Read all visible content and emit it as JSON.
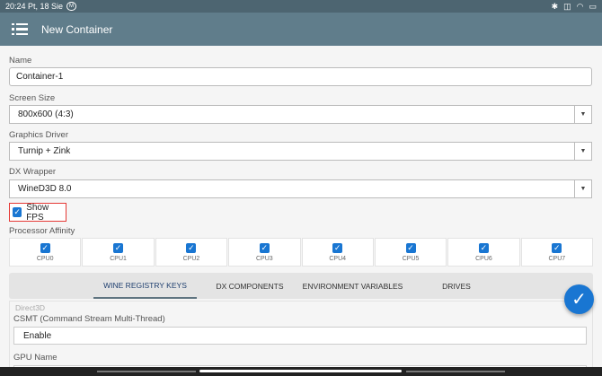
{
  "statusbar": {
    "time": "20:24 Pt, 18 Sie",
    "badge": "M",
    "bt": "✱",
    "vib": "◫",
    "wifi": "◠",
    "battery": "▭"
  },
  "appbar": {
    "title": "New Container"
  },
  "name": {
    "label": "Name",
    "value": "Container-1"
  },
  "screen_size": {
    "label": "Screen Size",
    "value": "800x600 (4:3)"
  },
  "graphics_driver": {
    "label": "Graphics Driver",
    "value": "Turnip + Zink"
  },
  "dx_wrapper": {
    "label": "DX Wrapper",
    "value": "WineD3D 8.0"
  },
  "show_fps": {
    "label": "Show FPS",
    "checked": true
  },
  "processor_affinity": {
    "label": "Processor Affinity",
    "cpus": [
      {
        "label": "CPU0",
        "checked": true
      },
      {
        "label": "CPU1",
        "checked": true
      },
      {
        "label": "CPU2",
        "checked": true
      },
      {
        "label": "CPU3",
        "checked": true
      },
      {
        "label": "CPU4",
        "checked": true
      },
      {
        "label": "CPU5",
        "checked": true
      },
      {
        "label": "CPU6",
        "checked": true
      },
      {
        "label": "CPU7",
        "checked": true
      }
    ]
  },
  "tabs": [
    {
      "label": "WINE REGISTRY KEYS",
      "active": true
    },
    {
      "label": "DX COMPONENTS",
      "active": false
    },
    {
      "label": "ENVIRONMENT VARIABLES",
      "active": false
    },
    {
      "label": "DRIVES",
      "active": false
    }
  ],
  "registry": {
    "section": "Direct3D",
    "csmt_label": "CSMT (Command Stream Multi-Thread)",
    "csmt_value": "Enable",
    "gpu_label": "GPU Name"
  },
  "colors": {
    "appbar": "#607d8b",
    "accent": "#1976d2",
    "highlight": "#e53935"
  }
}
